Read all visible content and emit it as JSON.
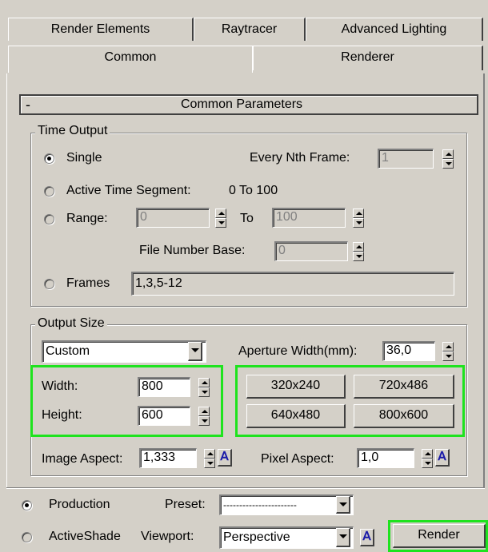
{
  "tabs": {
    "row1": [
      "Render Elements",
      "Raytracer",
      "Advanced Lighting"
    ],
    "row2": [
      "Common",
      "Renderer"
    ],
    "active": "Common"
  },
  "rollout": {
    "collapse_symbol": "-",
    "title": "Common Parameters"
  },
  "time_output": {
    "title": "Time Output",
    "single_label": "Single",
    "every_nth_label": "Every Nth Frame:",
    "every_nth_value": "1",
    "active_segment_label": "Active Time Segment:",
    "active_segment_value": "0 To 100",
    "range_label": "Range:",
    "range_from": "0",
    "range_to_label": "To",
    "range_to": "100",
    "file_number_base_label": "File Number Base:",
    "file_number_base_value": "0",
    "frames_label": "Frames",
    "frames_value": "1,3,5-12",
    "selected": "Single"
  },
  "output_size": {
    "title": "Output Size",
    "preset_value": "Custom",
    "aperture_label": "Aperture Width(mm):",
    "aperture_value": "36,0",
    "width_label": "Width:",
    "width_value": "800",
    "height_label": "Height:",
    "height_value": "600",
    "presets": [
      "320x240",
      "720x486",
      "640x480",
      "800x600"
    ],
    "image_aspect_label": "Image Aspect:",
    "image_aspect_value": "1,333",
    "pixel_aspect_label": "Pixel Aspect:",
    "pixel_aspect_value": "1,0"
  },
  "bottom": {
    "production_label": "Production",
    "activeshade_label": "ActiveShade",
    "preset_label": "Preset:",
    "preset_value": "-----------------------",
    "viewport_label": "Viewport:",
    "viewport_value": "Perspective",
    "render_label": "Render",
    "selected": "Production"
  },
  "colors": {
    "highlight": "#1ee31e",
    "panel": "#d4d0c8",
    "lock_icon": "#1a1aa8"
  },
  "icons": {
    "lock": "lock-icon"
  }
}
